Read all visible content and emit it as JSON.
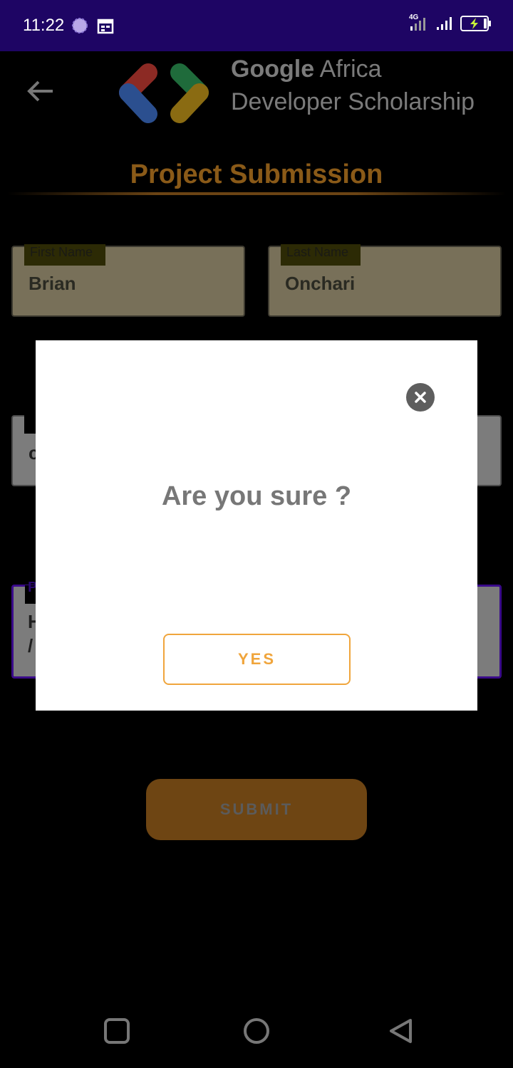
{
  "status_bar": {
    "time": "11:22",
    "network_type": "4G",
    "background_color": "#1e0564",
    "icons": [
      "aperture-icon",
      "calendar-icon",
      "signal-icon",
      "battery-charging-icon"
    ]
  },
  "header": {
    "back_icon": "arrow-left-icon",
    "brand_line1_bold": "Google",
    "brand_line1_rest": " Africa",
    "brand_line2": "Developer Scholarship",
    "title": "Project Submission",
    "title_color": "#8a5a18"
  },
  "form": {
    "first_name": {
      "label": "First Name",
      "value": "Brian"
    },
    "last_name": {
      "label": "Last Name",
      "value": "Onchari"
    },
    "email_partial": "c",
    "link_label_partial": "P",
    "link_partial_line1": "H",
    "link_partial_line2": "/",
    "submit_label": "SUBMIT"
  },
  "dialog": {
    "message": "Are you sure ?",
    "confirm_label": "YES",
    "close_icon": "close-circle-icon",
    "accent_color": "#f0a53c"
  },
  "nav_bar": {
    "buttons": [
      "recents-square-icon",
      "home-circle-icon",
      "back-triangle-icon"
    ]
  }
}
